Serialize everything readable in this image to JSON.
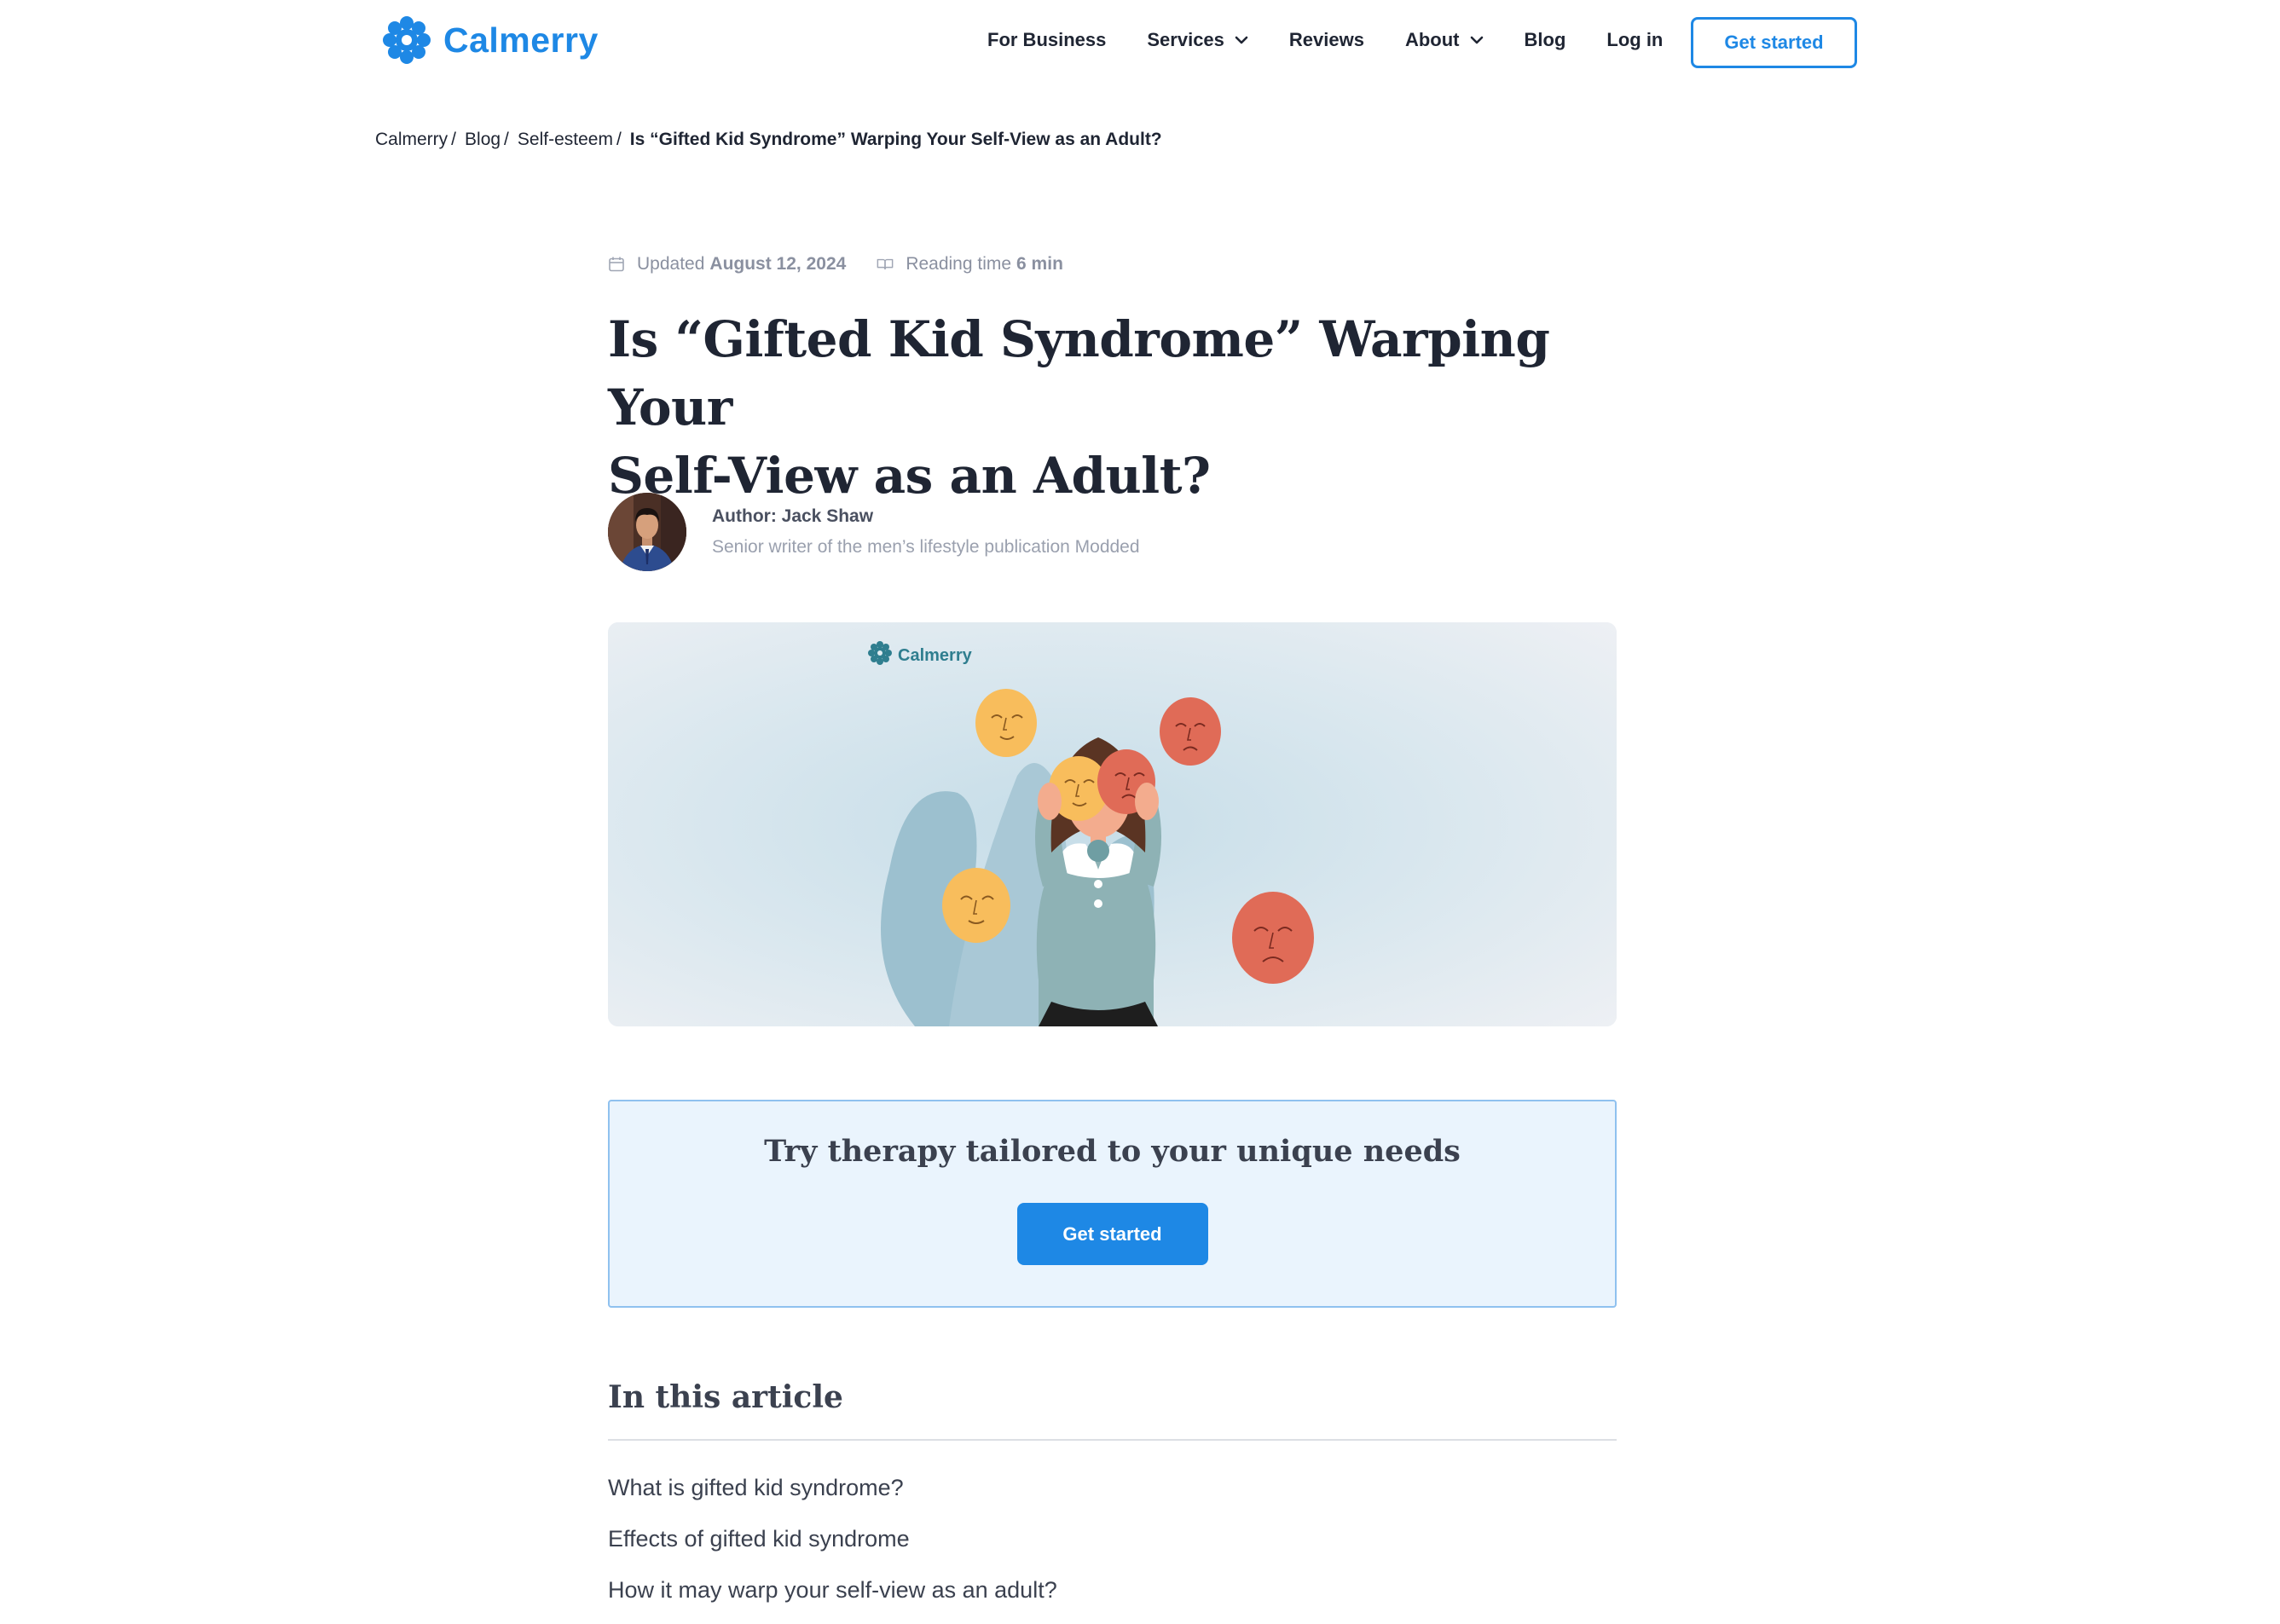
{
  "brand": {
    "name": "Calmerry",
    "color": "#1e88e5"
  },
  "nav": {
    "items": [
      {
        "label": "For Business",
        "dropdown": false
      },
      {
        "label": "Services",
        "dropdown": true
      },
      {
        "label": "Reviews",
        "dropdown": false
      },
      {
        "label": "About",
        "dropdown": true
      },
      {
        "label": "Blog",
        "dropdown": false
      },
      {
        "label": "Log in",
        "dropdown": false
      }
    ],
    "cta_label": "Get started"
  },
  "breadcrumb": {
    "items": [
      "Calmerry",
      "Blog",
      "Self-esteem"
    ],
    "separator": "/",
    "current": "Is “Gifted Kid Syndrome” Warping Your Self-View as an Adult?"
  },
  "meta": {
    "updated_label": "Updated",
    "updated_date": "August 12, 2024",
    "reading_label": "Reading time",
    "reading_value": "6 min"
  },
  "article": {
    "title_line1": "Is “Gifted Kid Syndrome” Warping Your",
    "title_line2": "Self-View as an Adult?"
  },
  "author": {
    "name_label": "Author: Jack Shaw",
    "role": "Senior writer of the men’s lifestyle publication Modded"
  },
  "hero": {
    "watermark": "Calmerry",
    "icons": [
      "woman-holding-masks-illustration",
      "happy-mask",
      "sad-mask"
    ]
  },
  "cta": {
    "title": "Try therapy tailored to your unique needs",
    "button": "Get started"
  },
  "toc": {
    "title": "In this article",
    "items": [
      "What is gifted kid syndrome?",
      "Effects of gifted kid syndrome",
      "How it may warp your self-view as an adult?"
    ]
  }
}
